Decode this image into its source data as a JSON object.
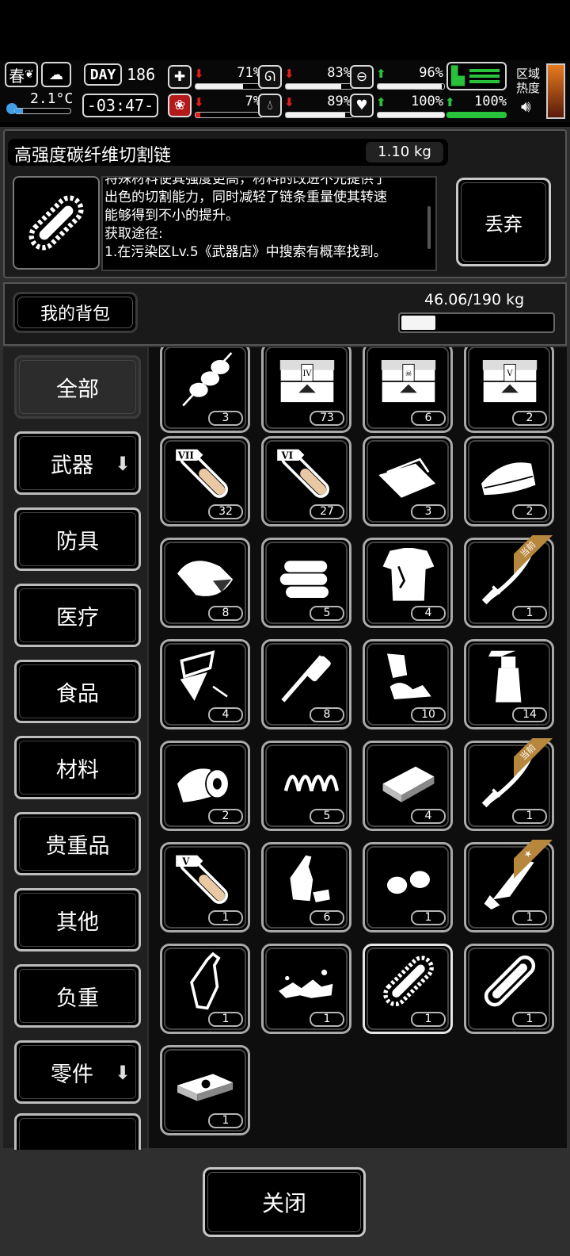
{
  "hud": {
    "season": "春",
    "temperature": "2.1°C",
    "day_label": "DAY",
    "day_number": "186",
    "clock": "-03:47-",
    "region_label_1": "区域",
    "region_label_2": "热度",
    "stats": [
      {
        "icon": "health-icon",
        "trend": "down",
        "percent": "71%",
        "level": 0.71
      },
      {
        "icon": "stomach-icon",
        "trend": "down",
        "percent": "83%",
        "level": 0.83
      },
      {
        "icon": "energy-icon",
        "trend": "up",
        "percent": "96%",
        "level": 0.96
      },
      {
        "icon": "brain-icon",
        "trend": "down",
        "percent": "7%",
        "level": 0.07
      },
      {
        "icon": "water-drop-icon",
        "trend": "down",
        "percent": "89%",
        "level": 0.89
      },
      {
        "icon": "heart-icon",
        "trend": "up",
        "percent": "100%",
        "level": 1.0
      },
      {
        "icon": "stamina-icon",
        "trend": "up",
        "percent": "100%",
        "level": 1.0
      }
    ]
  },
  "item": {
    "name": "高强度碳纤维切割链",
    "weight": "1.10 kg",
    "description_lines": [
      "特殊材料使其强度更高，材料的改进不光提供了",
      "出色的切割能力，同时减轻了链条重量使其转速",
      "能够得到不小的提升。",
      "获取途径:",
      "1.在污染区Lv.5《武器店》中搜索有概率找到。"
    ],
    "discard_label": "丢弃"
  },
  "bag": {
    "title": "我的背包",
    "capacity": "46.06/190 kg",
    "load_fraction": 0.24
  },
  "categories": [
    {
      "label": "全部",
      "active": true,
      "dl": false
    },
    {
      "label": "武器",
      "active": false,
      "dl": true
    },
    {
      "label": "防具",
      "active": false,
      "dl": false
    },
    {
      "label": "医疗",
      "active": false,
      "dl": false
    },
    {
      "label": "食品",
      "active": false,
      "dl": false
    },
    {
      "label": "材料",
      "active": false,
      "dl": false
    },
    {
      "label": "贵重品",
      "active": false,
      "dl": false
    },
    {
      "label": "其他",
      "active": false,
      "dl": false
    },
    {
      "label": "负重",
      "active": false,
      "dl": false
    },
    {
      "label": "零件",
      "active": false,
      "dl": true
    }
  ],
  "items": [
    {
      "icon": "skewer-icon",
      "qty": "3"
    },
    {
      "icon": "crate-iv-icon",
      "qty": "73"
    },
    {
      "icon": "crate-skull-icon",
      "qty": "6"
    },
    {
      "icon": "crate-v-icon",
      "qty": "2"
    },
    {
      "icon": "test-tube-vii-icon",
      "qty": "32",
      "tag": "VII"
    },
    {
      "icon": "test-tube-vi-icon",
      "qty": "27",
      "tag": "VI"
    },
    {
      "icon": "cloth-icon",
      "qty": "3"
    },
    {
      "icon": "towel-icon",
      "qty": "2"
    },
    {
      "icon": "raw-meat-icon",
      "qty": "8"
    },
    {
      "icon": "folded-cloth-icon",
      "qty": "5"
    },
    {
      "icon": "torn-shirt-icon",
      "qty": "4"
    },
    {
      "icon": "katana-icon",
      "qty": "1",
      "badge": "当前"
    },
    {
      "icon": "metal-scraps-icon",
      "qty": "4"
    },
    {
      "icon": "plunger-tool-icon",
      "qty": "8"
    },
    {
      "icon": "rags-icon",
      "qty": "10"
    },
    {
      "icon": "spray-bottle-icon",
      "qty": "14"
    },
    {
      "icon": "bandage-roll-icon",
      "qty": "2"
    },
    {
      "icon": "spring-icon",
      "qty": "5"
    },
    {
      "icon": "whetstone-icon",
      "qty": "4"
    },
    {
      "icon": "katana-icon",
      "qty": "1",
      "badge": "当前"
    },
    {
      "icon": "test-tube-v-icon",
      "qty": "1",
      "tag": "V"
    },
    {
      "icon": "crushed-bottle-icon",
      "qty": "6"
    },
    {
      "icon": "nuts-icon",
      "qty": "1"
    },
    {
      "icon": "machete-icon",
      "qty": "1",
      "badge": "★"
    },
    {
      "icon": "bottle-icon",
      "qty": "1"
    },
    {
      "icon": "rubble-icon",
      "qty": "1"
    },
    {
      "icon": "cutting-chain-icon",
      "qty": "1",
      "selected": true
    },
    {
      "icon": "chainsaw-part-icon",
      "qty": "1"
    },
    {
      "icon": "cash-stack-icon",
      "qty": "1"
    }
  ],
  "close_label": "关闭"
}
